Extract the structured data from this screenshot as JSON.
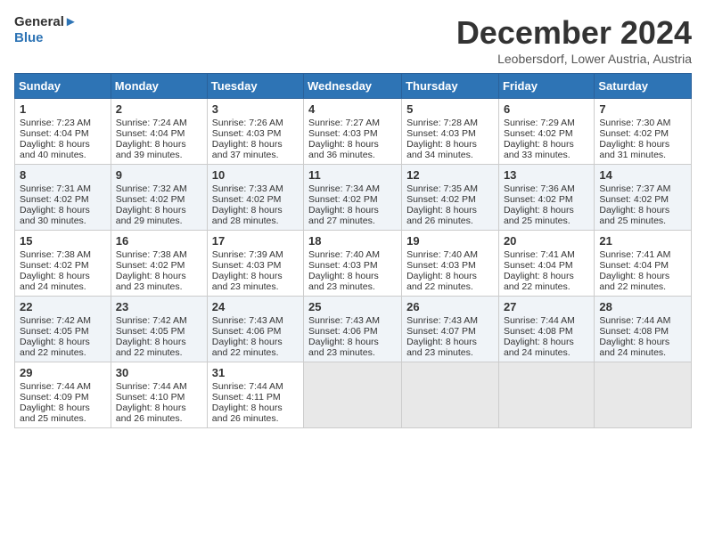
{
  "header": {
    "logo_line1": "General",
    "logo_line2": "Blue",
    "month": "December 2024",
    "location": "Leobersdorf, Lower Austria, Austria"
  },
  "days_of_week": [
    "Sunday",
    "Monday",
    "Tuesday",
    "Wednesday",
    "Thursday",
    "Friday",
    "Saturday"
  ],
  "weeks": [
    [
      {
        "day": "1",
        "lines": [
          "Sunrise: 7:23 AM",
          "Sunset: 4:04 PM",
          "Daylight: 8 hours",
          "and 40 minutes."
        ]
      },
      {
        "day": "2",
        "lines": [
          "Sunrise: 7:24 AM",
          "Sunset: 4:04 PM",
          "Daylight: 8 hours",
          "and 39 minutes."
        ]
      },
      {
        "day": "3",
        "lines": [
          "Sunrise: 7:26 AM",
          "Sunset: 4:03 PM",
          "Daylight: 8 hours",
          "and 37 minutes."
        ]
      },
      {
        "day": "4",
        "lines": [
          "Sunrise: 7:27 AM",
          "Sunset: 4:03 PM",
          "Daylight: 8 hours",
          "and 36 minutes."
        ]
      },
      {
        "day": "5",
        "lines": [
          "Sunrise: 7:28 AM",
          "Sunset: 4:03 PM",
          "Daylight: 8 hours",
          "and 34 minutes."
        ]
      },
      {
        "day": "6",
        "lines": [
          "Sunrise: 7:29 AM",
          "Sunset: 4:02 PM",
          "Daylight: 8 hours",
          "and 33 minutes."
        ]
      },
      {
        "day": "7",
        "lines": [
          "Sunrise: 7:30 AM",
          "Sunset: 4:02 PM",
          "Daylight: 8 hours",
          "and 31 minutes."
        ]
      }
    ],
    [
      {
        "day": "8",
        "lines": [
          "Sunrise: 7:31 AM",
          "Sunset: 4:02 PM",
          "Daylight: 8 hours",
          "and 30 minutes."
        ]
      },
      {
        "day": "9",
        "lines": [
          "Sunrise: 7:32 AM",
          "Sunset: 4:02 PM",
          "Daylight: 8 hours",
          "and 29 minutes."
        ]
      },
      {
        "day": "10",
        "lines": [
          "Sunrise: 7:33 AM",
          "Sunset: 4:02 PM",
          "Daylight: 8 hours",
          "and 28 minutes."
        ]
      },
      {
        "day": "11",
        "lines": [
          "Sunrise: 7:34 AM",
          "Sunset: 4:02 PM",
          "Daylight: 8 hours",
          "and 27 minutes."
        ]
      },
      {
        "day": "12",
        "lines": [
          "Sunrise: 7:35 AM",
          "Sunset: 4:02 PM",
          "Daylight: 8 hours",
          "and 26 minutes."
        ]
      },
      {
        "day": "13",
        "lines": [
          "Sunrise: 7:36 AM",
          "Sunset: 4:02 PM",
          "Daylight: 8 hours",
          "and 25 minutes."
        ]
      },
      {
        "day": "14",
        "lines": [
          "Sunrise: 7:37 AM",
          "Sunset: 4:02 PM",
          "Daylight: 8 hours",
          "and 25 minutes."
        ]
      }
    ],
    [
      {
        "day": "15",
        "lines": [
          "Sunrise: 7:38 AM",
          "Sunset: 4:02 PM",
          "Daylight: 8 hours",
          "and 24 minutes."
        ]
      },
      {
        "day": "16",
        "lines": [
          "Sunrise: 7:38 AM",
          "Sunset: 4:02 PM",
          "Daylight: 8 hours",
          "and 23 minutes."
        ]
      },
      {
        "day": "17",
        "lines": [
          "Sunrise: 7:39 AM",
          "Sunset: 4:03 PM",
          "Daylight: 8 hours",
          "and 23 minutes."
        ]
      },
      {
        "day": "18",
        "lines": [
          "Sunrise: 7:40 AM",
          "Sunset: 4:03 PM",
          "Daylight: 8 hours",
          "and 23 minutes."
        ]
      },
      {
        "day": "19",
        "lines": [
          "Sunrise: 7:40 AM",
          "Sunset: 4:03 PM",
          "Daylight: 8 hours",
          "and 22 minutes."
        ]
      },
      {
        "day": "20",
        "lines": [
          "Sunrise: 7:41 AM",
          "Sunset: 4:04 PM",
          "Daylight: 8 hours",
          "and 22 minutes."
        ]
      },
      {
        "day": "21",
        "lines": [
          "Sunrise: 7:41 AM",
          "Sunset: 4:04 PM",
          "Daylight: 8 hours",
          "and 22 minutes."
        ]
      }
    ],
    [
      {
        "day": "22",
        "lines": [
          "Sunrise: 7:42 AM",
          "Sunset: 4:05 PM",
          "Daylight: 8 hours",
          "and 22 minutes."
        ]
      },
      {
        "day": "23",
        "lines": [
          "Sunrise: 7:42 AM",
          "Sunset: 4:05 PM",
          "Daylight: 8 hours",
          "and 22 minutes."
        ]
      },
      {
        "day": "24",
        "lines": [
          "Sunrise: 7:43 AM",
          "Sunset: 4:06 PM",
          "Daylight: 8 hours",
          "and 22 minutes."
        ]
      },
      {
        "day": "25",
        "lines": [
          "Sunrise: 7:43 AM",
          "Sunset: 4:06 PM",
          "Daylight: 8 hours",
          "and 23 minutes."
        ]
      },
      {
        "day": "26",
        "lines": [
          "Sunrise: 7:43 AM",
          "Sunset: 4:07 PM",
          "Daylight: 8 hours",
          "and 23 minutes."
        ]
      },
      {
        "day": "27",
        "lines": [
          "Sunrise: 7:44 AM",
          "Sunset: 4:08 PM",
          "Daylight: 8 hours",
          "and 24 minutes."
        ]
      },
      {
        "day": "28",
        "lines": [
          "Sunrise: 7:44 AM",
          "Sunset: 4:08 PM",
          "Daylight: 8 hours",
          "and 24 minutes."
        ]
      }
    ],
    [
      {
        "day": "29",
        "lines": [
          "Sunrise: 7:44 AM",
          "Sunset: 4:09 PM",
          "Daylight: 8 hours",
          "and 25 minutes."
        ]
      },
      {
        "day": "30",
        "lines": [
          "Sunrise: 7:44 AM",
          "Sunset: 4:10 PM",
          "Daylight: 8 hours",
          "and 26 minutes."
        ]
      },
      {
        "day": "31",
        "lines": [
          "Sunrise: 7:44 AM",
          "Sunset: 4:11 PM",
          "Daylight: 8 hours",
          "and 26 minutes."
        ]
      },
      {
        "day": "",
        "lines": []
      },
      {
        "day": "",
        "lines": []
      },
      {
        "day": "",
        "lines": []
      },
      {
        "day": "",
        "lines": []
      }
    ]
  ]
}
